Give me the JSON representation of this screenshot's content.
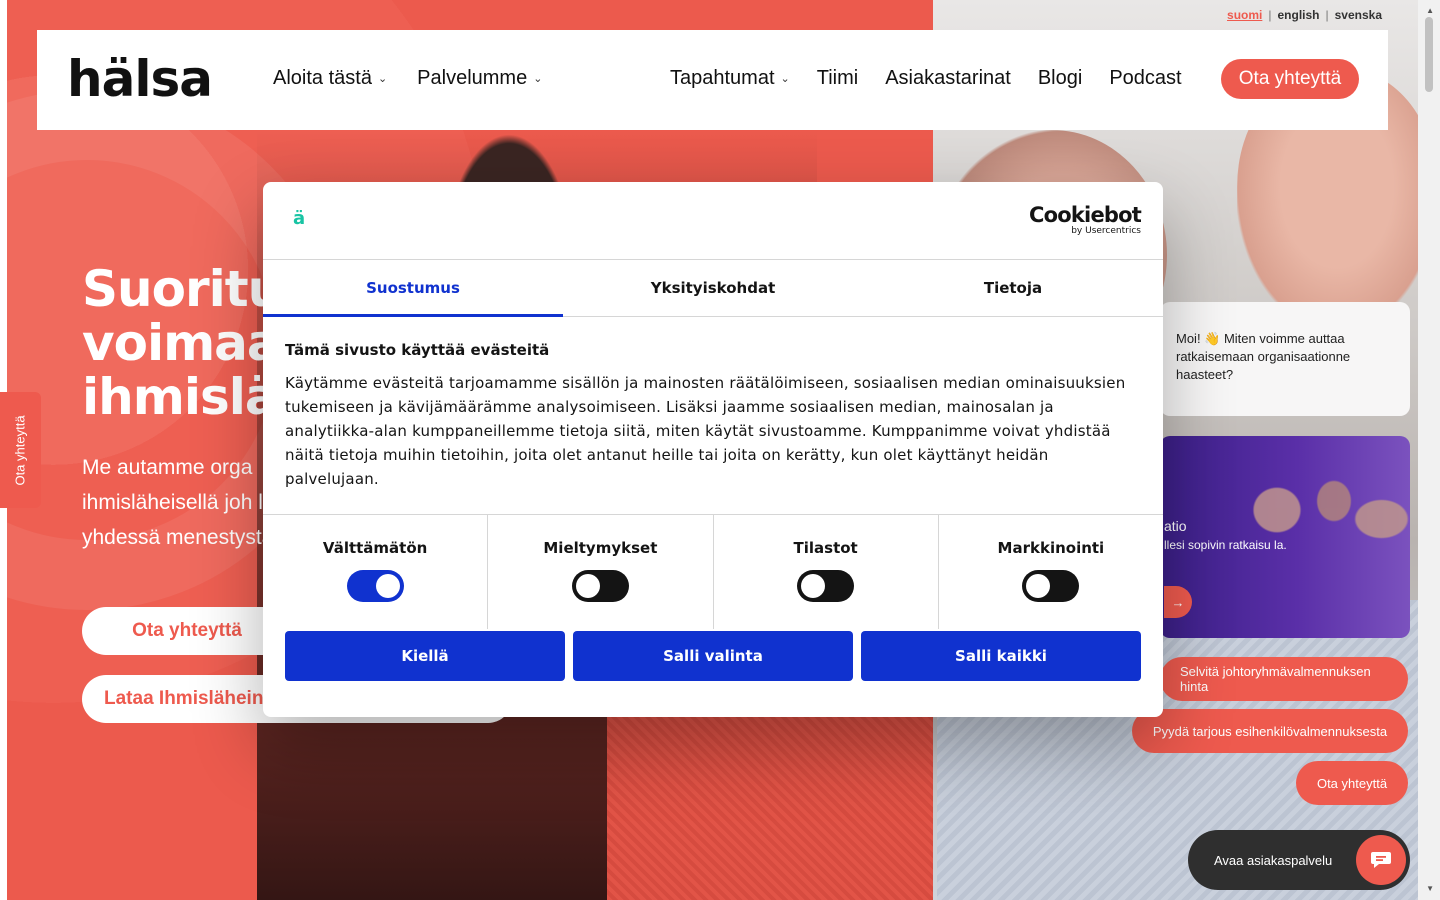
{
  "lang": {
    "items": [
      "suomi",
      "english",
      "svenska"
    ],
    "active": "suomi"
  },
  "header": {
    "logo": "hälsa",
    "nav_left": [
      "Aloita tästä",
      "Palvelumme"
    ],
    "nav_right": [
      "Tapahtumat",
      "Tiimi",
      "Asiakastarinat",
      "Blogi",
      "Podcast"
    ],
    "contact_label": "Ota yhteyttä"
  },
  "hero": {
    "title_lines": [
      "Suoritu",
      "voimaa",
      "ihmislä"
    ],
    "subtitle": "Me autamme orga ihmisläheisellä joh lähdetään yhdessä menestystä.",
    "btn_contact": "Ota yhteyttä",
    "btn_download": "Lataa Ihmisläheine"
  },
  "side_tab": {
    "label": "Ota yhteyttä"
  },
  "chat": {
    "bubble_text": "Moi! 👋 Miten voimme auttaa ratkaisemaan organisaationne haasteet?",
    "promo_title": "atio",
    "promo_text": "llesi sopivin ratkaisu la.",
    "promo_arrow": "→",
    "pill_1": "Selvitä johtoryhmävalmennuksen hinta",
    "pill_2": "Pyydä tarjous esihenkilövalmennuksesta",
    "pill_3": "Ota yhteyttä",
    "open_label": "Avaa asiakaspalvelu"
  },
  "cookie": {
    "brand_a": "ä",
    "provider_main": "Cookiebot",
    "provider_sub": "by Usercentrics",
    "tabs": [
      "Suostumus",
      "Yksityiskohdat",
      "Tietoja"
    ],
    "active_tab": "Suostumus",
    "heading": "Tämä sivusto käyttää evästeitä",
    "body": "Käytämme evästeitä tarjoamamme sisällön ja mainosten räätälöimiseen, sosiaalisen median ominaisuuksien tukemiseen ja kävijämäärämme analysoimiseen. Lisäksi jaamme sosiaalisen median, mainosalan ja analytiikka-alan kumppaneillemme tietoja siitä, miten käytät sivustoamme. Kumppanimme voivat yhdistää näitä tietoja muihin tietoihin, joita olet antanut heille tai joita on kerätty, kun olet käyttänyt heidän palvelujaan.",
    "toggles": [
      {
        "label": "Välttämätön",
        "on": true
      },
      {
        "label": "Mieltymykset",
        "on": false
      },
      {
        "label": "Tilastot",
        "on": false
      },
      {
        "label": "Markkinointi",
        "on": false
      }
    ],
    "btn_deny": "Kiellä",
    "btn_allow_selection": "Salli valinta",
    "btn_allow_all": "Salli kaikki"
  },
  "colors": {
    "brand": "#ee5a4e",
    "cookie_blue": "#1032cf",
    "accent_green": "#18c4a4"
  }
}
